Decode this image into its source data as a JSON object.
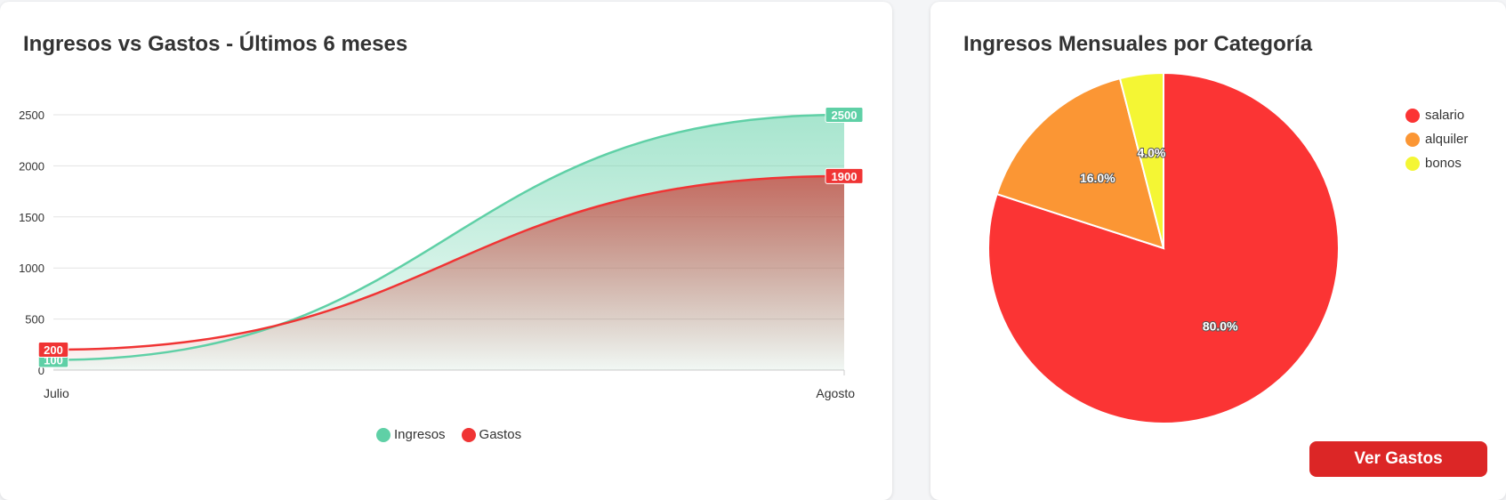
{
  "line_card": {
    "title": "Ingresos vs Gastos - Últimos 6 meses"
  },
  "pie_card": {
    "title": "Ingresos Mensuales por Categoría",
    "button_label": "Ver Gastos"
  },
  "colors": {
    "ingresos": "#5fd0a6",
    "gastos": "#f03434",
    "salario": "#fb3434",
    "alquiler": "#fb9634",
    "bonos": "#f4f634",
    "button": "#dc2626"
  },
  "chart_data": [
    {
      "type": "area",
      "title": "Ingresos vs Gastos - Últimos 6 meses",
      "categories": [
        "Julio",
        "Agosto"
      ],
      "series": [
        {
          "name": "Ingresos",
          "values": [
            100,
            2500
          ]
        },
        {
          "name": "Gastos",
          "values": [
            200,
            1900
          ]
        }
      ],
      "ylim": [
        0,
        2500
      ],
      "yticks": [
        0,
        500,
        1000,
        1500,
        2000,
        2500
      ],
      "grid": true,
      "legend": "bottom"
    },
    {
      "type": "pie",
      "title": "Ingresos Mensuales por Categoría",
      "categories": [
        "salario",
        "alquiler",
        "bonos"
      ],
      "values": [
        80,
        16,
        4
      ],
      "labels": [
        "80.0%",
        "16.0%",
        "4.0%"
      ],
      "legend": "right"
    }
  ]
}
